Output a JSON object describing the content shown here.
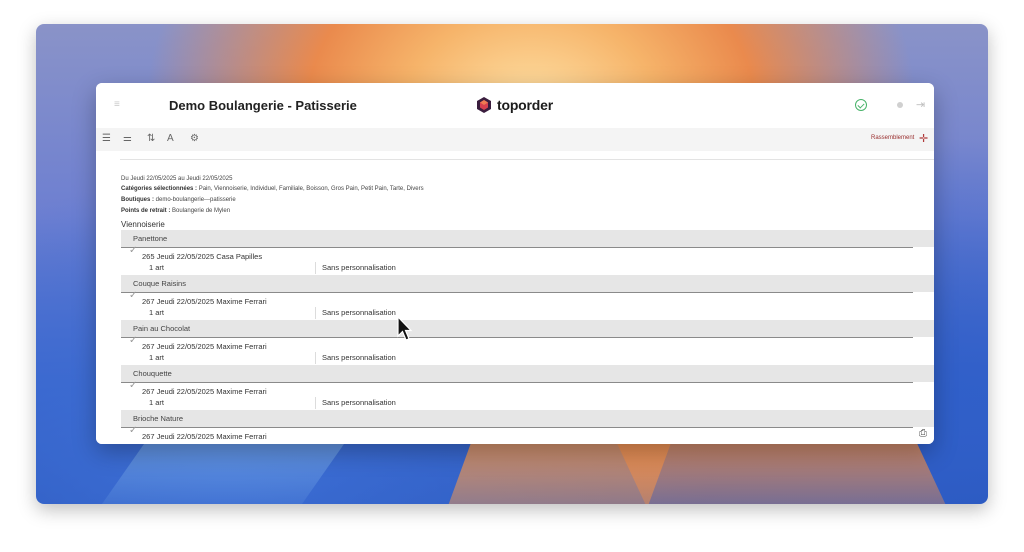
{
  "header": {
    "title": "Demo Boulangerie - Patisserie",
    "logo_text": "toporder",
    "menu_icon": "≡"
  },
  "toolbar": {
    "icons": [
      "list-check",
      "sliders",
      "sort",
      "text-size",
      "settings"
    ],
    "rassemblement_label": "Rassemblement"
  },
  "filters": {
    "date_range": "Du Jeudi 22/05/2025 au Jeudi 22/05/2025",
    "categories_label": "Catégories sélectionnées :",
    "categories_value": " Pain, Viennoiserie, Individuel, Familiale, Boisson, Gros Pain, Petit Pain, Tarte, Divers",
    "boutiques_label": "Boutiques :",
    "boutiques_value": " demo-boulangerie---patisserie",
    "points_label": "Points de retrait :",
    "points_value": " Boulangerie de Mylen"
  },
  "section": "Viennoiserie",
  "products": [
    {
      "name": "Panettone",
      "order": "265   Jeudi 22/05/2025   Casa Papilles",
      "qty": "1 art",
      "perso": "Sans personnalisation"
    },
    {
      "name": "Couque Raisins",
      "order": "267   Jeudi 22/05/2025   Maxime Ferrari",
      "qty": "1 art",
      "perso": "Sans personnalisation"
    },
    {
      "name": "Pain au Chocolat",
      "order": "267   Jeudi 22/05/2025   Maxime Ferrari",
      "qty": "1 art",
      "perso": "Sans personnalisation"
    },
    {
      "name": "Chouquette",
      "order": "267   Jeudi 22/05/2025   Maxime Ferrari",
      "qty": "1 art",
      "perso": "Sans personnalisation"
    },
    {
      "name": "Brioche Nature",
      "order": "267   Jeudi 22/05/2025   Maxime Ferrari"
    }
  ],
  "colors": {
    "accent": "#9a3030",
    "sync": "#49b36a",
    "header_bg": "#e6e6e6"
  }
}
